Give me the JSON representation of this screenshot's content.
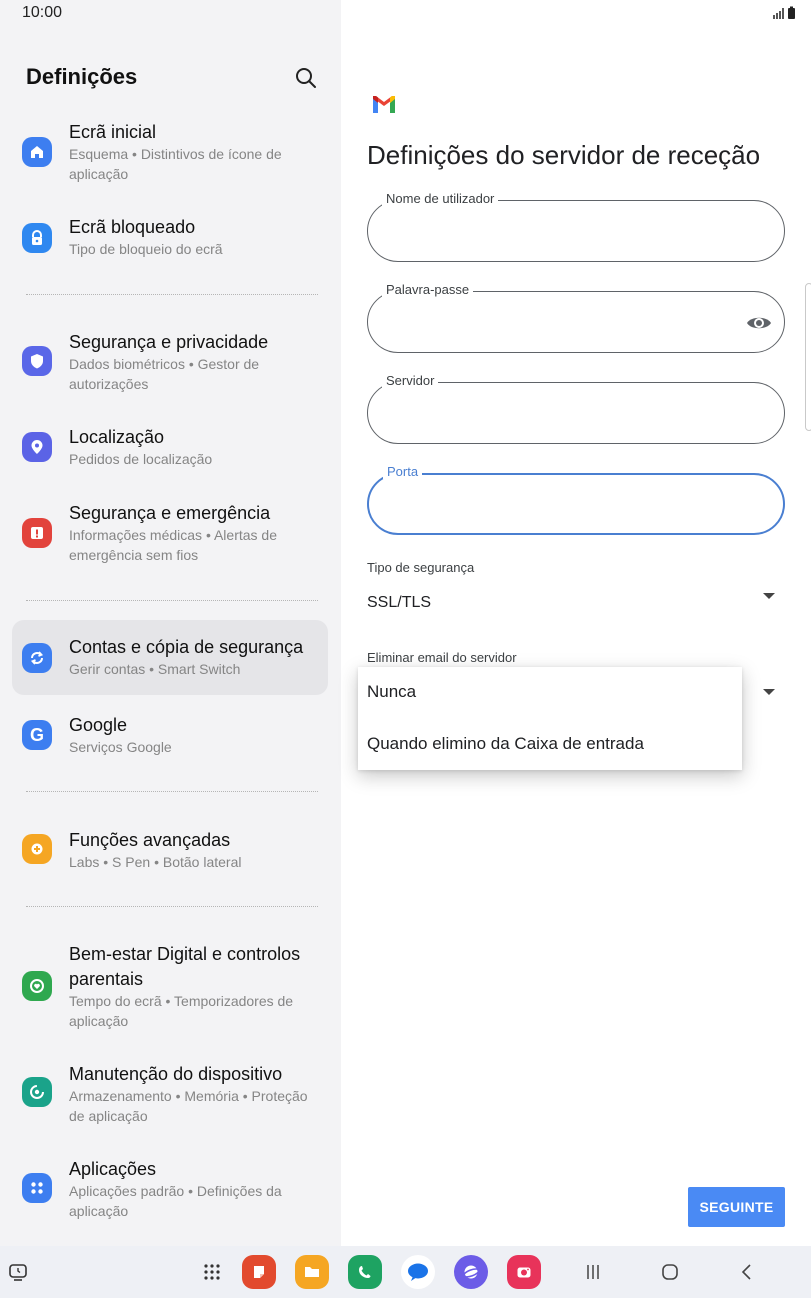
{
  "status": {
    "time": "10:00"
  },
  "settings": {
    "title": "Definições",
    "items": [
      {
        "title": "Ecrã inicial",
        "subtitle": "Esquema  •  Distintivos de ícone de aplicação",
        "icon": "home-icon",
        "color": "#3d7ef0"
      },
      {
        "title": "Ecrã bloqueado",
        "subtitle": "Tipo de bloqueio do ecrã",
        "icon": "lock-icon",
        "color": "#2f88f0"
      },
      {
        "title": "Segurança e privacidade",
        "subtitle": "Dados biométricos  •  Gestor de autorizações",
        "icon": "shield-icon",
        "color": "#5a67e8"
      },
      {
        "title": "Localização",
        "subtitle": "Pedidos de localização",
        "icon": "location-pin-icon",
        "color": "#5b63e6"
      },
      {
        "title": "Segurança e emergência",
        "subtitle": "Informações médicas  •  Alertas de emergência sem fios",
        "icon": "emergency-icon",
        "color": "#e2433c"
      },
      {
        "title": "Contas e cópia de segurança",
        "subtitle": "Gerir contas  •  Smart Switch",
        "icon": "sync-icon",
        "color": "#3d7ef0"
      },
      {
        "title": "Google",
        "subtitle": "Serviços Google",
        "icon": "google-icon",
        "color": "#3d7ef0"
      },
      {
        "title": "Funções avançadas",
        "subtitle": "Labs  •  S Pen  •  Botão lateral",
        "icon": "gear-plus-icon",
        "color": "#f5a623"
      },
      {
        "title": "Bem-estar Digital e controlos parentais",
        "subtitle": "Tempo do ecrã  •  Temporizadores de aplicação",
        "icon": "wellbeing-icon",
        "color": "#2fa84f"
      },
      {
        "title": "Manutenção do dispositivo",
        "subtitle": "Armazenamento  •  Memória  •  Proteção de aplicação",
        "icon": "care-icon",
        "color": "#1aa38a"
      },
      {
        "title": "Aplicações",
        "subtitle": "Aplicações padrão  •  Definições da aplicação",
        "icon": "apps-icon",
        "color": "#3d7ef0"
      }
    ]
  },
  "form": {
    "title": "Definições do servidor de receção",
    "fields": {
      "username": {
        "label": "Nome de utilizador",
        "value": ""
      },
      "password": {
        "label": "Palavra-passe",
        "value": ""
      },
      "server": {
        "label": "Servidor",
        "value": ""
      },
      "port": {
        "label": "Porta",
        "value": ""
      }
    },
    "security": {
      "label": "Tipo de segurança",
      "value": "SSL/TLS"
    },
    "delete_email": {
      "label": "Eliminar email do servidor"
    },
    "dropdown_options": [
      "Nunca",
      "Quando elimino da Caixa de entrada"
    ],
    "next_label": "SEGUINTE",
    "accent": "#4a8af4",
    "focus_color": "#4a7fd1"
  },
  "taskbar": {
    "icons": [
      "recent-screen-icon",
      "app-drawer-icon",
      "notes-app-icon",
      "files-app-icon",
      "phone-app-icon",
      "messages-app-icon",
      "internet-app-icon",
      "camera-app-icon",
      "recents-nav-icon",
      "home-nav-icon",
      "back-nav-icon"
    ]
  }
}
